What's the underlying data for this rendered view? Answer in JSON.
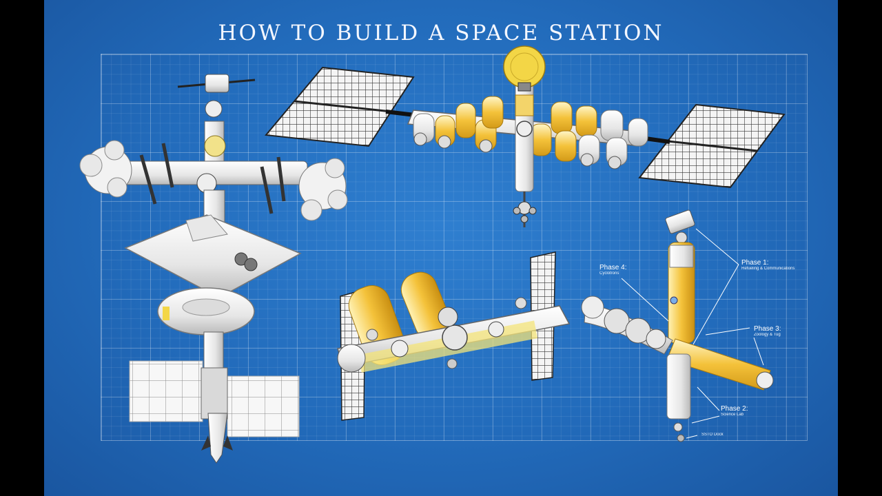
{
  "title": "HOW TO BUILD A SPACE STATION",
  "labels": {
    "phase1": {
      "heading": "Phase 1:",
      "sub": "Refueling & Communications"
    },
    "phase2": {
      "heading": "Phase 2:",
      "sub": "Science Lab"
    },
    "phase3": {
      "heading": "Phase 3:",
      "sub": "Zoology & Tug"
    },
    "phase4": {
      "heading": "Phase 4:",
      "sub": "Cyclotrons"
    },
    "dock": {
      "heading": "SSTO Dock"
    }
  },
  "colors": {
    "blueprint": "#226bbb",
    "module": "#f2f2f2",
    "tank": "#f2c03a",
    "panel": "#f5f5f5"
  }
}
